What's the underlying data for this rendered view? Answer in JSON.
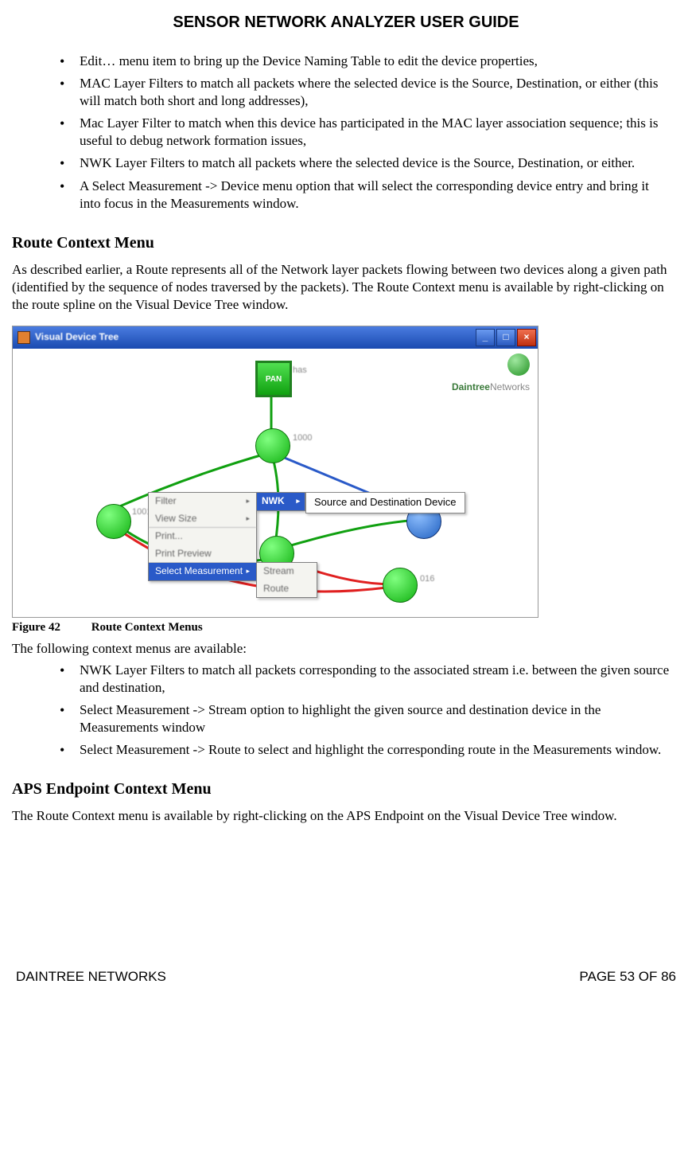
{
  "header": {
    "title": "SENSOR NETWORK ANALYZER USER GUIDE"
  },
  "topBullets": [
    "Edit… menu item to bring up the Device Naming Table to edit the device properties,",
    "MAC Layer Filters to match all packets where the selected device is the Source, Destination, or either (this will match both short and long addresses),",
    "Mac Layer Filter to match when this device has participated in the MAC layer association sequence; this is useful to debug network formation issues,",
    "NWK Layer Filters to match all packets where the selected device is the Source, Destination, or either.",
    "A Select Measurement -> Device menu option that will select the corresponding device entry and bring it into focus in the Measurements window."
  ],
  "section1": {
    "heading": "Route Context Menu",
    "para": "As described earlier, a Route represents all of the Network layer packets flowing between two devices along a given path (identified by the sequence of nodes traversed by the packets). The Route Context menu is available by right-clicking on the route spline on the Visual Device Tree window."
  },
  "screenshot": {
    "windowTitle": "Visual Device Tree",
    "logoText1": "Daintree",
    "logoText2": "Networks",
    "panLabel": "PAN",
    "nodeLabels": {
      "top": "has",
      "right1": "1000",
      "left1": "1001",
      "far": "016"
    },
    "menu": {
      "items": [
        "Filter",
        "View Size",
        "Print...",
        "Print Preview",
        "Select Measurement"
      ],
      "sub1": "NWK",
      "sub2": "Source and Destination Device",
      "subbelow": [
        "Stream",
        "Route"
      ]
    }
  },
  "figure": {
    "label": "Figure 42",
    "title": "Route Context Menus"
  },
  "afterFigure": {
    "intro": "The following context menus are available:",
    "bullets": [
      "NWK Layer Filters to match all packets corresponding to the associated stream i.e. between the given source and destination,",
      "Select Measurement -> Stream option to highlight the given source and destination device in the Measurements window",
      "Select Measurement -> Route to select and highlight the corresponding route in the Measurements window."
    ]
  },
  "section2": {
    "heading": "APS Endpoint Context Menu",
    "para": "The Route Context menu is available by right-clicking on the APS Endpoint on the Visual Device Tree window."
  },
  "footer": {
    "left": "DAINTREE NETWORKS",
    "right": "PAGE 53 OF 86"
  }
}
